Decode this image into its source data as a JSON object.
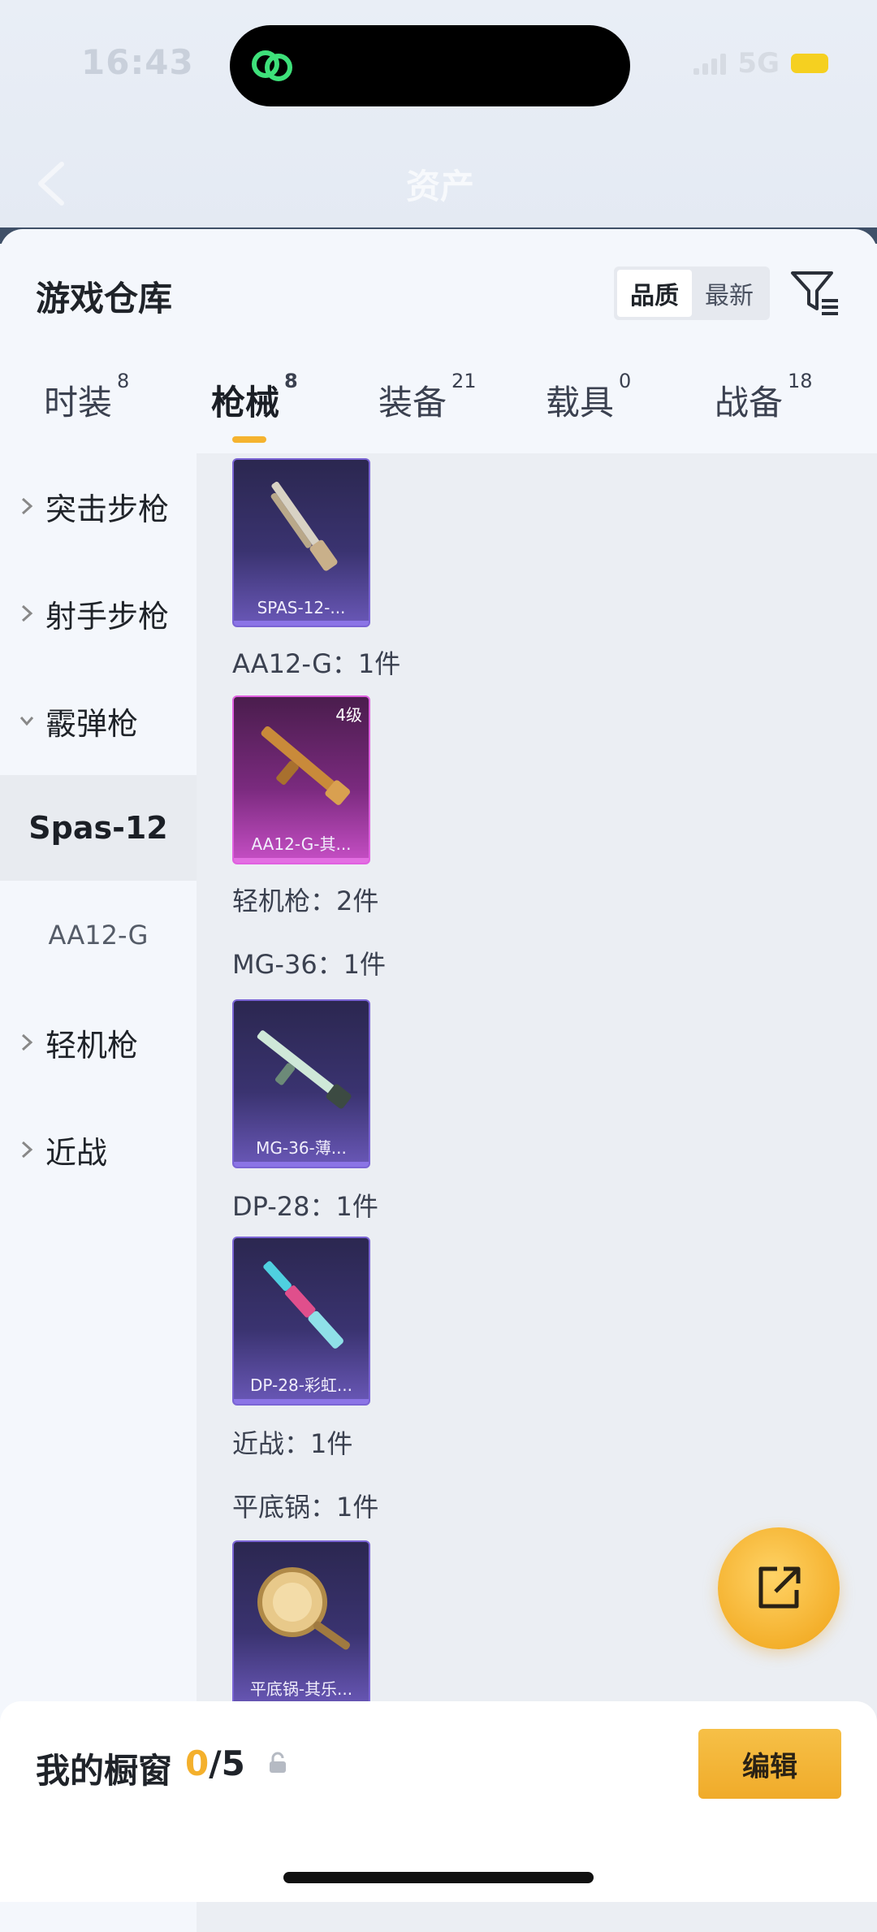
{
  "status": {
    "time": "16:43",
    "network": "5G"
  },
  "header": {
    "title": "资产"
  },
  "sheet": {
    "title": "游戏仓库",
    "sort_options": [
      "品质",
      "最新"
    ],
    "sort_selected": "品质"
  },
  "tabs": [
    {
      "label": "时装",
      "count": "8"
    },
    {
      "label": "枪械",
      "count": "8"
    },
    {
      "label": "装备",
      "count": "21"
    },
    {
      "label": "载具",
      "count": "0"
    },
    {
      "label": "战备",
      "count": "18"
    }
  ],
  "active_tab": "枪械",
  "nav": {
    "items": [
      {
        "label": "突击步枪"
      },
      {
        "label": "射手步枪"
      },
      {
        "label": "霰弹枪"
      },
      {
        "label": "Spas-12"
      },
      {
        "label": "AA12-G"
      },
      {
        "label": "轻机枪"
      },
      {
        "label": "近战"
      }
    ]
  },
  "content": {
    "cards": [
      {
        "label": "SPAS-12-...",
        "rarity": "purple"
      },
      {
        "label": "AA12-G-其...",
        "rarity": "pink",
        "level": "4级"
      },
      {
        "label": "MG-36-薄...",
        "rarity": "purple"
      },
      {
        "label": "DP-28-彩虹...",
        "rarity": "purple"
      },
      {
        "label": "平底锅-其乐...",
        "rarity": "purple"
      }
    ],
    "counts": [
      "AA12-G：1件",
      "轻机枪：2件",
      "MG-36：1件",
      "DP-28：1件",
      "近战：1件",
      "平底锅：1件"
    ]
  },
  "window": {
    "label": "我的橱窗",
    "current": "0",
    "total": "/5"
  },
  "edit_label": "编辑",
  "colors": {
    "accent": "#f4b02c",
    "rarity_purple": "#7a64d4",
    "rarity_pink": "#e060e0"
  }
}
